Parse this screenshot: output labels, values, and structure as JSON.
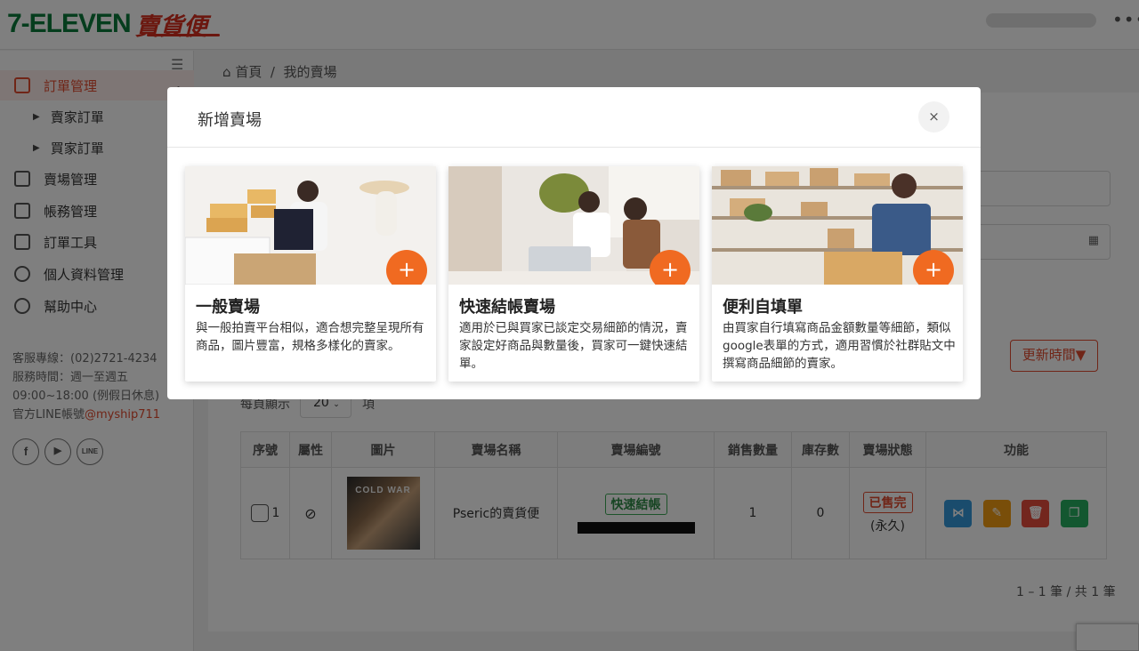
{
  "header": {
    "logo_brand": "7-ELEVEN",
    "logo_product": "賣貨便",
    "more_label": "•••"
  },
  "sidebar": {
    "items": [
      {
        "label": "訂單管理",
        "icon": "clipboard-icon",
        "active": true
      },
      {
        "label": "賣家訂單",
        "sub": true
      },
      {
        "label": "買家訂單",
        "sub": true
      },
      {
        "label": "賣場管理",
        "icon": "store-icon"
      },
      {
        "label": "帳務管理",
        "icon": "wallet-icon"
      },
      {
        "label": "訂單工具",
        "icon": "briefcase-icon"
      },
      {
        "label": "個人資料管理",
        "icon": "gear-icon"
      },
      {
        "label": "幫助中心",
        "icon": "help-icon"
      }
    ],
    "service_line": "客服專線：(02)2721-4234",
    "service_time": "服務時間：週一至週五",
    "service_hours": "09:00~18:00 (例假日休息)",
    "line_label": "官方LINE帳號",
    "line_id": "@myship711",
    "social": [
      "f",
      "▶",
      "LINE"
    ]
  },
  "breadcrumb": {
    "home": "首頁",
    "separator": "/",
    "current": "我的賣場"
  },
  "toolbar": {
    "update_label": "更新時間▼",
    "perpage_label": "每頁顯示",
    "perpage_value": "20",
    "perpage_unit": "項"
  },
  "table": {
    "headers": [
      "序號",
      "屬性",
      "圖片",
      "賣場名稱",
      "賣場編號",
      "銷售數量",
      "庫存數",
      "賣場狀態",
      "功能"
    ],
    "row": {
      "index": "1",
      "thumb_text": "COLD WAR",
      "name": "Pseric的賣貨便",
      "type_badge": "快速結帳",
      "sold": "1",
      "stock": "0",
      "status": "已售完",
      "status_note": "(永久)"
    },
    "pagination": "1 – 1 筆 / 共 1 筆"
  },
  "modal": {
    "title": "新增賣場",
    "close_label": "×",
    "options": [
      {
        "title": "一般賣場",
        "desc": "與一般拍賣平台相似，適合想完整呈現所有商品，圖片豐富，規格多樣化的賣家。",
        "plus": "+"
      },
      {
        "title": "快速結帳賣場",
        "desc": "適用於已與買家已談定交易細節的情況，賣家設定好商品與數量後，買家可一鍵快速結單。",
        "plus": "+"
      },
      {
        "title": "便利自填單",
        "desc": "由買家自行填寫商品金額數量等細節，類似google表單的方式，適用習慣於社群貼文中撰寫商品細節的賣家。",
        "plus": "+"
      }
    ]
  },
  "colors": {
    "brand_red": "#e04a2f",
    "plus_orange": "#f06a21",
    "seven_green": "#0a7a3a",
    "share_blue": "#3498db",
    "edit_orange": "#f39c12",
    "delete_red": "#e74c3c",
    "copy_green": "#27ae60"
  }
}
